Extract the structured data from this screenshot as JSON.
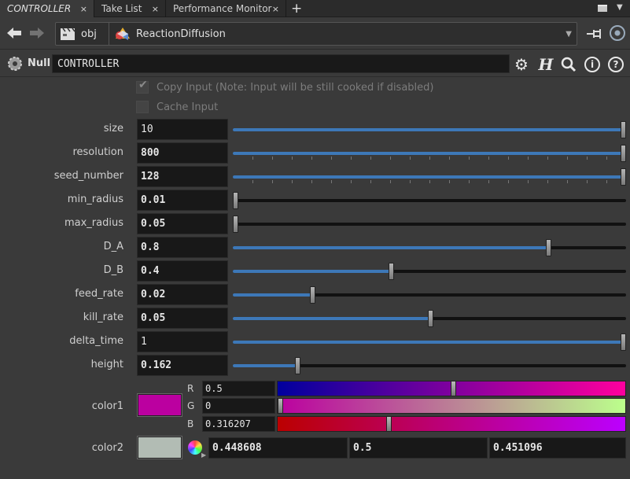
{
  "tabs": [
    {
      "label": "CONTROLLER",
      "active": true,
      "closable": true
    },
    {
      "label": "Take List",
      "active": false,
      "closable": true
    },
    {
      "label": "Performance Monitor",
      "active": false,
      "closable": true
    }
  ],
  "tab_close_glyph": "×",
  "tab_add_glyph": "+",
  "path": {
    "root": "obj",
    "node": "ReactionDiffusion"
  },
  "node_header": {
    "type_label": "Null",
    "name": "CONTROLLER"
  },
  "checkboxes": {
    "copy_input": {
      "label": "Copy Input (Note: Input will be still cooked if disabled)",
      "checked": true,
      "disabled": true
    },
    "cache_input": {
      "label": "Cache Input",
      "checked": false,
      "disabled": true
    }
  },
  "params": [
    {
      "label": "size",
      "value": "10",
      "bold": false,
      "fraction": 1.0,
      "ticks": false
    },
    {
      "label": "resolution",
      "value": "800",
      "bold": true,
      "fraction": 1.0,
      "ticks": true
    },
    {
      "label": "seed_number",
      "value": "128",
      "bold": true,
      "fraction": 1.0,
      "ticks": true
    },
    {
      "label": "min_radius",
      "value": "0.01",
      "bold": true,
      "fraction": 0.0,
      "ticks": false
    },
    {
      "label": "max_radius",
      "value": "0.05",
      "bold": true,
      "fraction": 0.0,
      "ticks": false
    },
    {
      "label": "D_A",
      "value": "0.8",
      "bold": true,
      "fraction": 0.8,
      "ticks": false
    },
    {
      "label": "D_B",
      "value": "0.4",
      "bold": true,
      "fraction": 0.4,
      "ticks": false
    },
    {
      "label": "feed_rate",
      "value": "0.02",
      "bold": true,
      "fraction": 0.2,
      "ticks": false
    },
    {
      "label": "kill_rate",
      "value": "0.05",
      "bold": true,
      "fraction": 0.5,
      "ticks": false
    },
    {
      "label": "delta_time",
      "value": "1",
      "bold": false,
      "fraction": 1.0,
      "ticks": false
    },
    {
      "label": "height",
      "value": "0.162",
      "bold": true,
      "fraction": 0.162,
      "ticks": false
    }
  ],
  "color1": {
    "label": "color1",
    "swatch": "#bb00a0",
    "channels": [
      {
        "name": "R",
        "value": "0.5",
        "fraction": 0.5
      },
      {
        "name": "G",
        "value": "0",
        "fraction": 0.0
      },
      {
        "name": "B",
        "value": "0.316207",
        "fraction": 0.316207
      }
    ]
  },
  "color2": {
    "label": "color2",
    "swatch": "#b2bcb4",
    "values": [
      "0.448608",
      "0.5",
      "0.451096"
    ]
  },
  "colors": {
    "accent": "#3d78b8",
    "background": "#3a3a3a",
    "field": "#181818"
  }
}
